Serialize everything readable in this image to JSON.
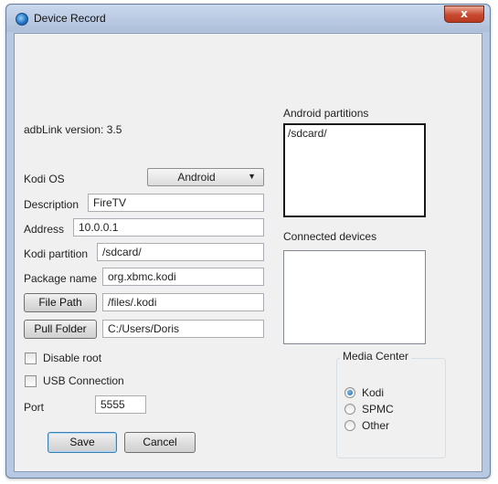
{
  "window": {
    "title": "Device Record",
    "close_label": "x"
  },
  "version_label": "adbLink version: 3.5",
  "kodi_os": {
    "label": "Kodi OS",
    "selected": "Android"
  },
  "description": {
    "label": "Description",
    "value": "FireTV"
  },
  "address": {
    "label": "Address",
    "value": "10.0.0.1"
  },
  "kodi_partition": {
    "label": "Kodi partition",
    "value": "/sdcard/"
  },
  "package_name": {
    "label": "Package name",
    "value": "org.xbmc.kodi"
  },
  "file_path": {
    "button_label": "File Path",
    "value": "/files/.kodi"
  },
  "pull_folder": {
    "button_label": "Pull Folder",
    "value": "C:/Users/Doris"
  },
  "options": {
    "disable_root": {
      "label": "Disable root",
      "checked": false
    },
    "usb_connection": {
      "label": "USB Connection",
      "checked": false
    }
  },
  "port": {
    "label": "Port",
    "value": "5555"
  },
  "buttons": {
    "save": "Save",
    "cancel": "Cancel"
  },
  "android_partitions": {
    "label": "Android partitions",
    "items": [
      "/sdcard/"
    ]
  },
  "connected_devices": {
    "label": "Connected devices",
    "items": []
  },
  "media_center": {
    "label": "Media Center",
    "selected": "Kodi",
    "options": [
      "Kodi",
      "SPMC",
      "Other"
    ]
  }
}
